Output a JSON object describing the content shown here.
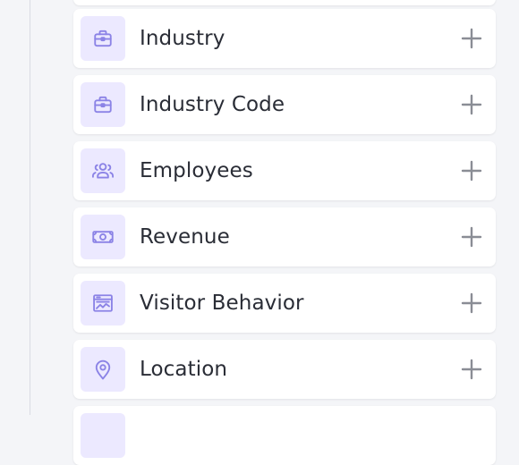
{
  "filters": {
    "items": [
      {
        "label": "Industry",
        "icon": "briefcase-icon"
      },
      {
        "label": "Industry Code",
        "icon": "briefcase-icon"
      },
      {
        "label": "Employees",
        "icon": "users-icon"
      },
      {
        "label": "Revenue",
        "icon": "money-icon"
      },
      {
        "label": "Visitor Behavior",
        "icon": "browser-chart-icon"
      },
      {
        "label": "Location",
        "icon": "location-pin-icon"
      }
    ]
  },
  "colors": {
    "accent": "#8b83e6",
    "icon_bg": "#ece9ff",
    "plus": "#8a8d95",
    "text": "#2a2d36"
  }
}
